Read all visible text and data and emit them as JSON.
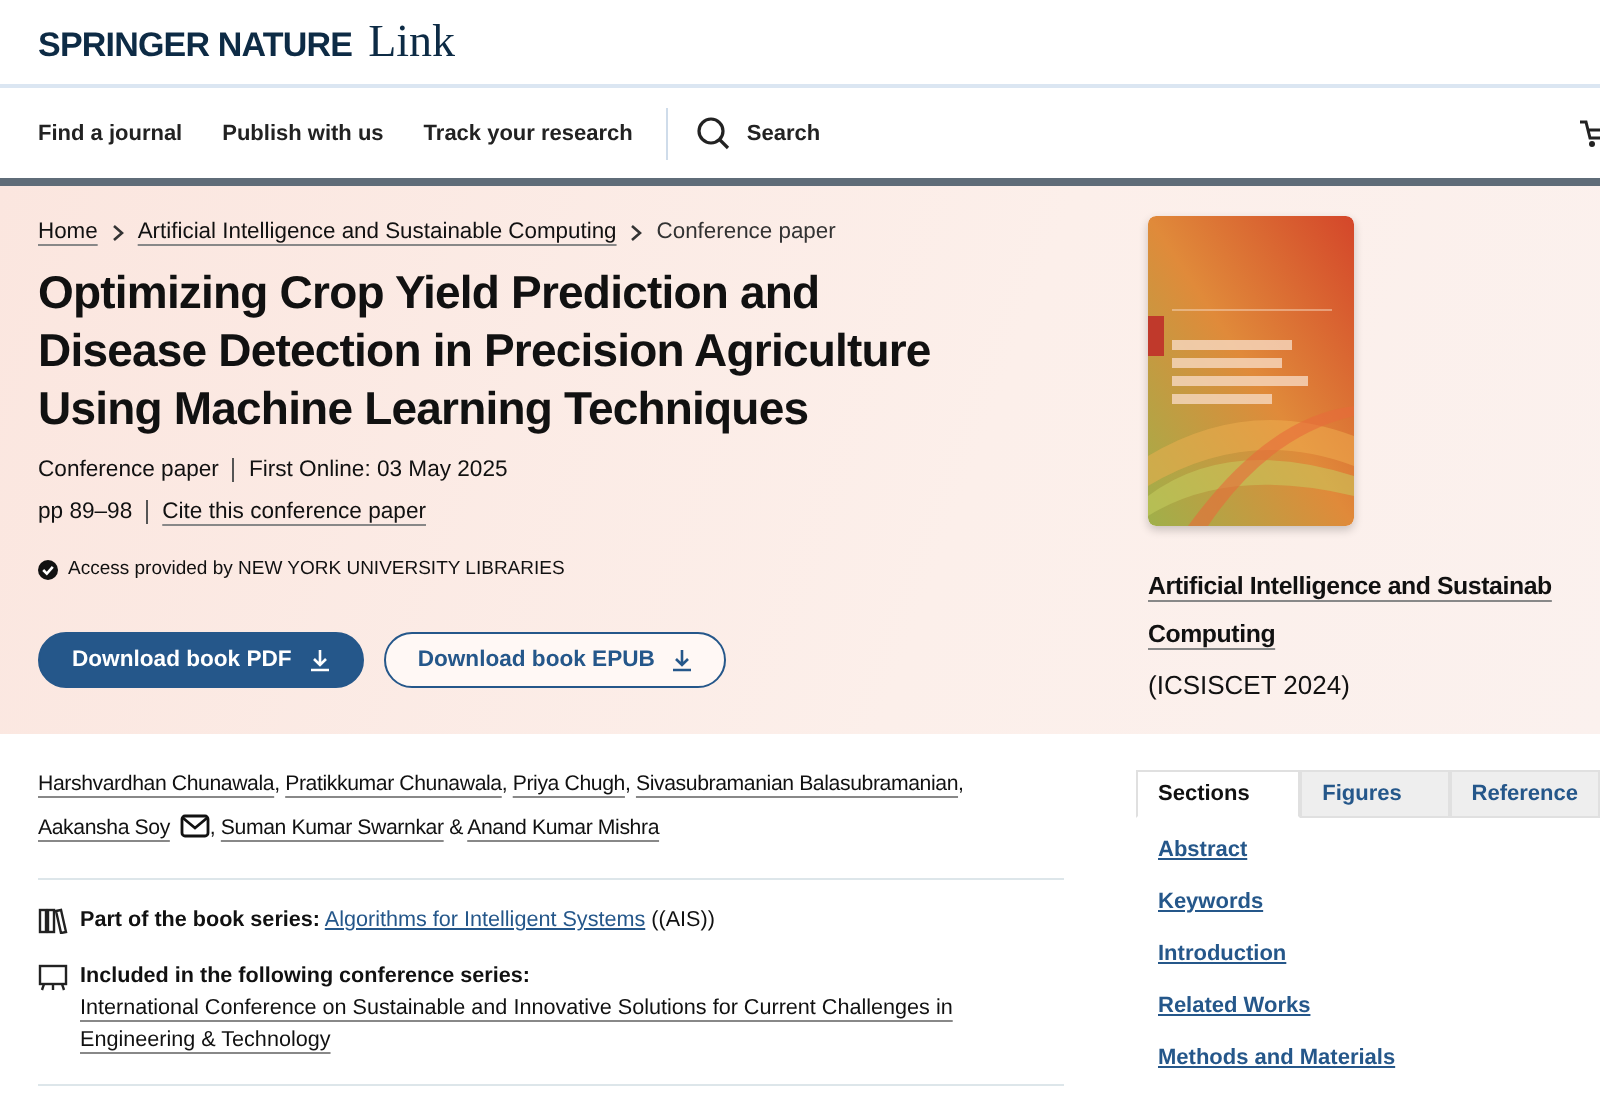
{
  "brand": {
    "name": "SPRINGER NATURE",
    "product": "Link"
  },
  "nav": {
    "items": [
      "Find a journal",
      "Publish with us",
      "Track your research"
    ],
    "search": "Search"
  },
  "breadcrumbs": [
    {
      "label": "Home",
      "link": true
    },
    {
      "label": "Artificial Intelligence and Sustainable Computing",
      "link": true
    },
    {
      "label": "Conference paper",
      "link": false
    }
  ],
  "title": "Optimizing Crop Yield Prediction and Disease Detection in Precision Agriculture Using Machine Learning Techniques",
  "meta": {
    "type": "Conference paper",
    "published": "First Online: 03 May 2025",
    "pages": "pp 89–98",
    "cite": "Cite this conference paper"
  },
  "access": "Access provided by NEW YORK UNIVERSITY LIBRARIES",
  "buttons": [
    {
      "label": "Download book PDF",
      "primary": true
    },
    {
      "label": "Download book EPUB",
      "primary": false
    }
  ],
  "book": {
    "title": "Artificial Intelligence and Sustainab",
    "title_2": "Computing",
    "conference": "(ICSISCET 2024)"
  },
  "authors": [
    {
      "name": "Harshvardhan Chunawala",
      "contact": false,
      "sep": ","
    },
    {
      "name": "Pratikkumar Chunawala",
      "contact": false,
      "sep": ","
    },
    {
      "name": "Priya Chugh",
      "contact": false,
      "sep": ","
    },
    {
      "name": "Sivasubramanian Balasubramanian",
      "contact": false,
      "sep": ","
    },
    {
      "name": "Aakansha Soy",
      "contact": true,
      "sep": ","
    },
    {
      "name": "Suman Kumar Swarnkar",
      "contact": false,
      "sep": "&"
    },
    {
      "name": "Anand Kumar Mishra",
      "contact": false
    }
  ],
  "series": {
    "label": "Part of the book series:",
    "link": "Algorithms for Intelligent Systems",
    "suffix": "((AIS))"
  },
  "conference_series": {
    "label": "Included in the following conference series:",
    "link": "International Conference on Sustainable and Innovative Solutions for Current Challenges in Engineering & Technology"
  },
  "tabs": [
    {
      "label": "Sections",
      "selected": true
    },
    {
      "label": "Figures",
      "selected": false
    },
    {
      "label": "Reference",
      "selected": false
    }
  ],
  "sections": [
    "Abstract",
    "Keywords",
    "Introduction",
    "Related Works",
    "Methods and Materials"
  ]
}
